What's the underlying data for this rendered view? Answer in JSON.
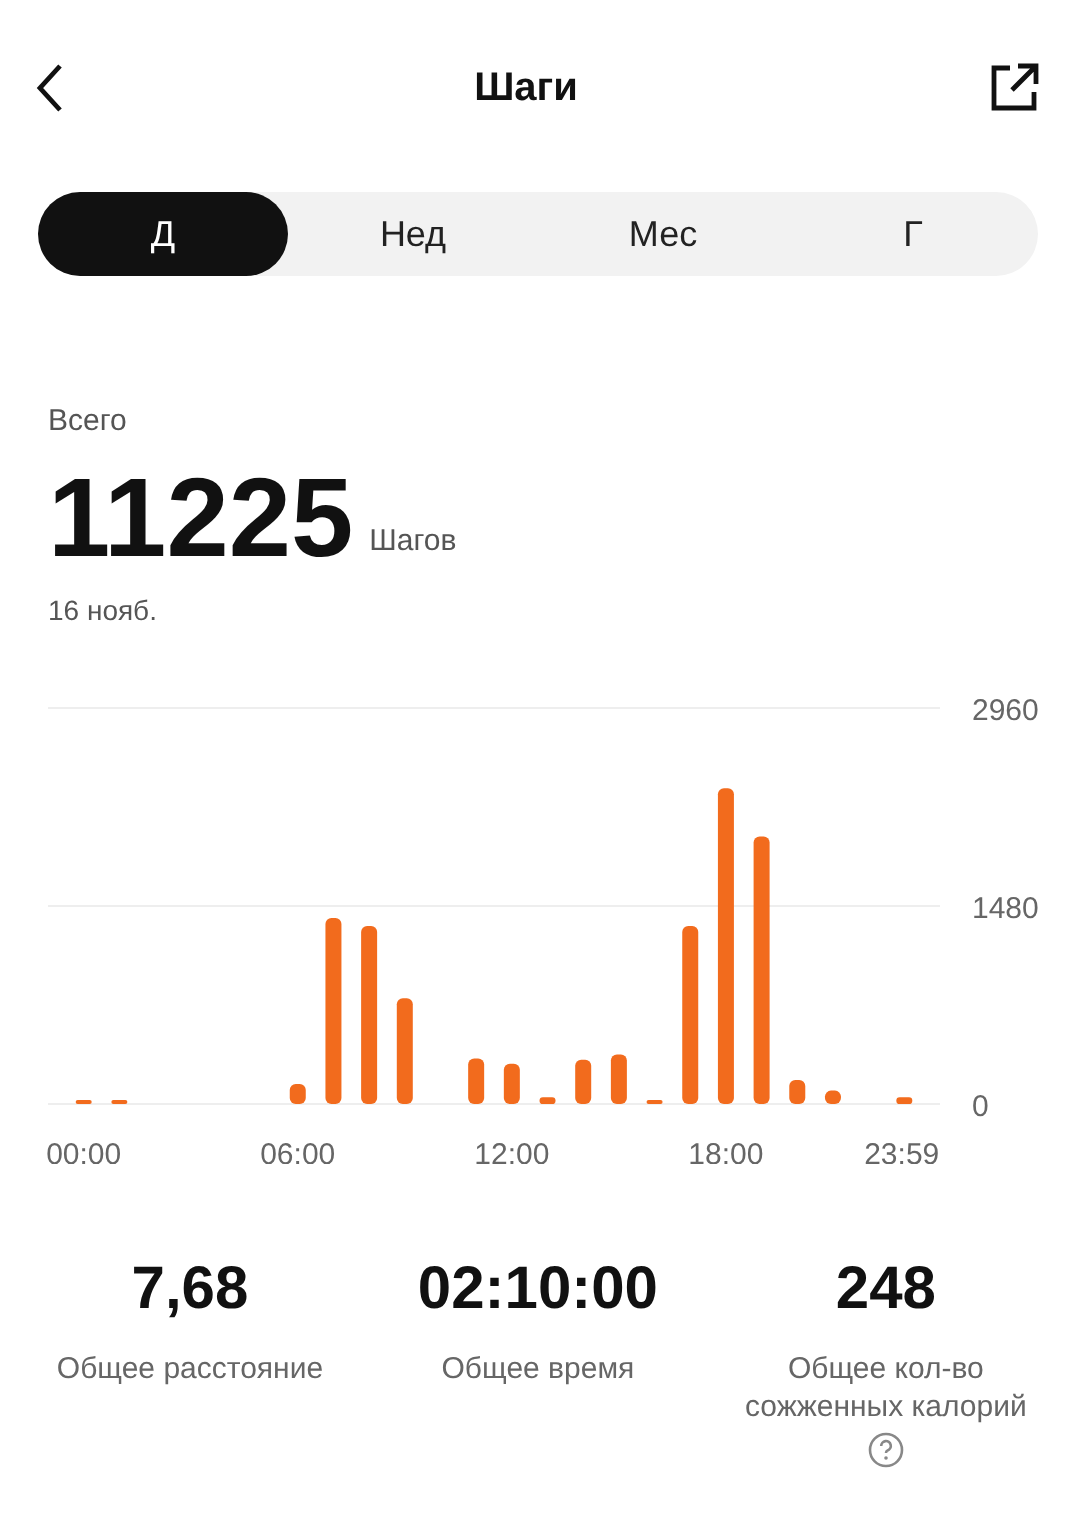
{
  "header": {
    "title": "Шаги"
  },
  "tabs": [
    {
      "label": "Д",
      "selected": true
    },
    {
      "label": "Нед",
      "selected": false
    },
    {
      "label": "Мес",
      "selected": false
    },
    {
      "label": "Г",
      "selected": false
    }
  ],
  "summary": {
    "label": "Всего",
    "value": "11225",
    "unit": "Шагов",
    "date": "16 нояб."
  },
  "chart": {
    "chart_data": {
      "type": "bar",
      "x": [
        0,
        1,
        2,
        3,
        4,
        5,
        6,
        7,
        8,
        9,
        10,
        11,
        12,
        13,
        14,
        15,
        16,
        17,
        18,
        19,
        20,
        21,
        22,
        23
      ],
      "xlim": [
        -1,
        24
      ],
      "series": [
        {
          "color": "#f26b1d",
          "values": [
            10,
            10,
            0,
            0,
            0,
            0,
            150,
            1390,
            1330,
            790,
            0,
            340,
            300,
            50,
            330,
            370,
            20,
            1330,
            2360,
            2000,
            180,
            100,
            0,
            50
          ]
        }
      ],
      "ylim": [
        0,
        2960
      ],
      "yticks": [
        0,
        1480,
        2960
      ],
      "xticks": [
        {
          "value": 0,
          "label": "00:00"
        },
        {
          "value": 6,
          "label": "06:00"
        },
        {
          "value": 12,
          "label": "12:00"
        },
        {
          "value": 18,
          "label": "18:00"
        },
        {
          "value": 23.98,
          "label": "23:59"
        }
      ]
    }
  },
  "stats": [
    {
      "value": "7,68",
      "label": "Общее расстояние"
    },
    {
      "value": "02:10:00",
      "label": "Общее время"
    },
    {
      "value": "248",
      "label": "Общее кол-во сожженных калорий",
      "help": true
    }
  ]
}
